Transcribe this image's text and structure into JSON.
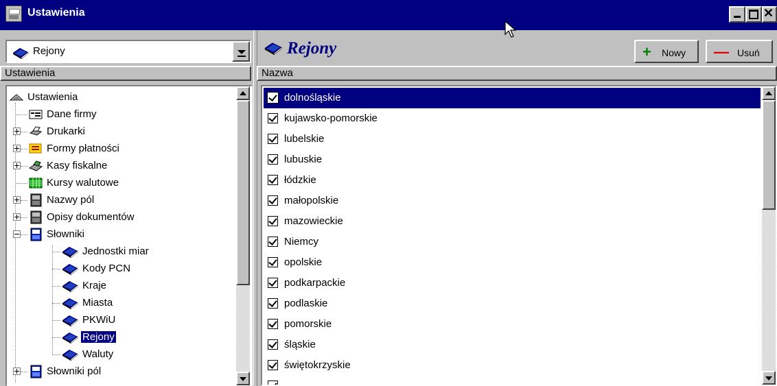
{
  "window": {
    "title": "Ustawienia"
  },
  "combo": {
    "value": "Rejony"
  },
  "left_header": "Ustawienia",
  "tree": {
    "items": [
      {
        "label": "Ustawienia",
        "icon": "drawer-icon"
      },
      {
        "label": "Dane firmy",
        "icon": "company-card-icon"
      },
      {
        "label": "Drukarki",
        "icon": "printer-icon"
      },
      {
        "label": "Formy płatności",
        "icon": "payment-form-icon"
      },
      {
        "label": "Kasy fiskalne",
        "icon": "cash-register-icon"
      },
      {
        "label": "Kursy walutowe",
        "icon": "grid-table-icon"
      },
      {
        "label": "Nazwy pól",
        "icon": "field-names-icon"
      },
      {
        "label": "Opisy dokumentów",
        "icon": "document-descriptions-icon"
      },
      {
        "label": "Słowniki",
        "icon": "dictionary-icon"
      },
      {
        "label": "Jednostki miar",
        "icon": "book-icon"
      },
      {
        "label": "Kody PCN",
        "icon": "book-icon"
      },
      {
        "label": "Kraje",
        "icon": "book-icon"
      },
      {
        "label": "Miasta",
        "icon": "book-icon"
      },
      {
        "label": "PKWiU",
        "icon": "book-icon"
      },
      {
        "label": "Rejony",
        "icon": "book-icon"
      },
      {
        "label": "Waluty",
        "icon": "book-icon"
      },
      {
        "label": "Słowniki pól",
        "icon": "dictionary-icon"
      }
    ]
  },
  "right": {
    "title": "Rejony",
    "new_label": "Nowy",
    "delete_label": "Usuń",
    "column_header": "Nazwa"
  },
  "list": {
    "rows": [
      "dolnośląskie",
      "kujawsko-pomorskie",
      "lubelskie",
      "lubuskie",
      "łódzkie",
      "małopolskie",
      "mazowieckie",
      "Niemcy",
      "opolskie",
      "podkarpackie",
      "podlaskie",
      "pomorskie",
      "śląskie",
      "świętokrzyskie"
    ],
    "selected": "dolnośląskie"
  },
  "colors": {
    "title_bar": "#000080",
    "selection": "#000080",
    "new_icon": "#008000",
    "delete_icon": "#e00000"
  }
}
